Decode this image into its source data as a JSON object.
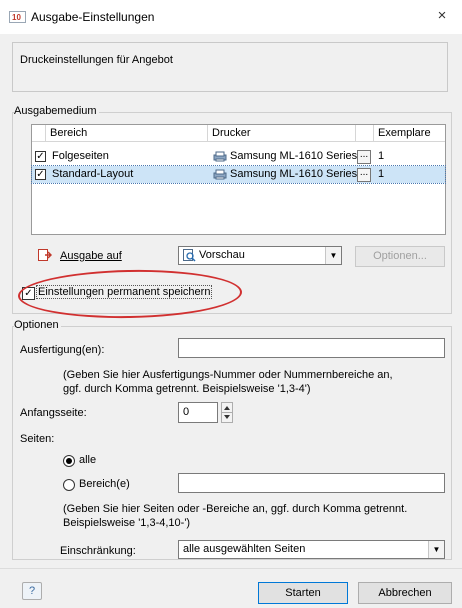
{
  "window": {
    "title": "Ausgabe-Einstellungen",
    "close_glyph": "×",
    "icon_text": "1 · 10"
  },
  "header": {
    "text": "Druckeinstellungen für Angebot"
  },
  "ausgabemedium": {
    "label": "Ausgabemedium",
    "columns": [
      "Bereich",
      "Drucker",
      "Exemplare"
    ],
    "rows": [
      {
        "checked": true,
        "bereich": "Folgeseiten",
        "drucker": "Samsung ML-1610 Series",
        "dots": "...",
        "exemplare": "1",
        "selected": false
      },
      {
        "checked": true,
        "bereich": "Standard-Layout",
        "drucker": "Samsung ML-1610 Series",
        "dots": "...",
        "exemplare": "1",
        "selected": true
      }
    ],
    "ausgabe_auf_label": "Ausgabe auf",
    "ausgabe_auf_value": "Vorschau",
    "optionen_button": "Optionen...",
    "permanent_label": "Einstellungen permanent speichern",
    "permanent_checked": true
  },
  "optionen": {
    "label": "Optionen",
    "ausfertigung_label": "Ausfertigung(en):",
    "ausfertigung_value": "",
    "ausfertigung_hint": "(Geben Sie hier Ausfertigungs-Nummer oder Nummernbereiche an, ggf. durch Komma getrennt. Beispielsweise '1,3-4')",
    "anfangsseite_label": "Anfangsseite:",
    "anfangsseite_value": "0",
    "seiten_label": "Seiten:",
    "radio_alle": "alle",
    "radio_bereich": "Bereich(e)",
    "selected_radio": "alle",
    "bereich_value": "",
    "bereich_hint": "(Geben Sie hier Seiten oder -Bereiche an, ggf. durch Komma getrennt. Beispielsweise '1,3-4,10-')",
    "einschraenkung_label": "Einschränkung:",
    "einschraenkung_value": "alle ausgewählten Seiten"
  },
  "footer": {
    "help_glyph": "?",
    "start_button": "Starten",
    "cancel_button": "Abbrechen"
  },
  "colors": {
    "highlight_ellipse": "#d13030",
    "selected_row": "#cde4f7"
  }
}
